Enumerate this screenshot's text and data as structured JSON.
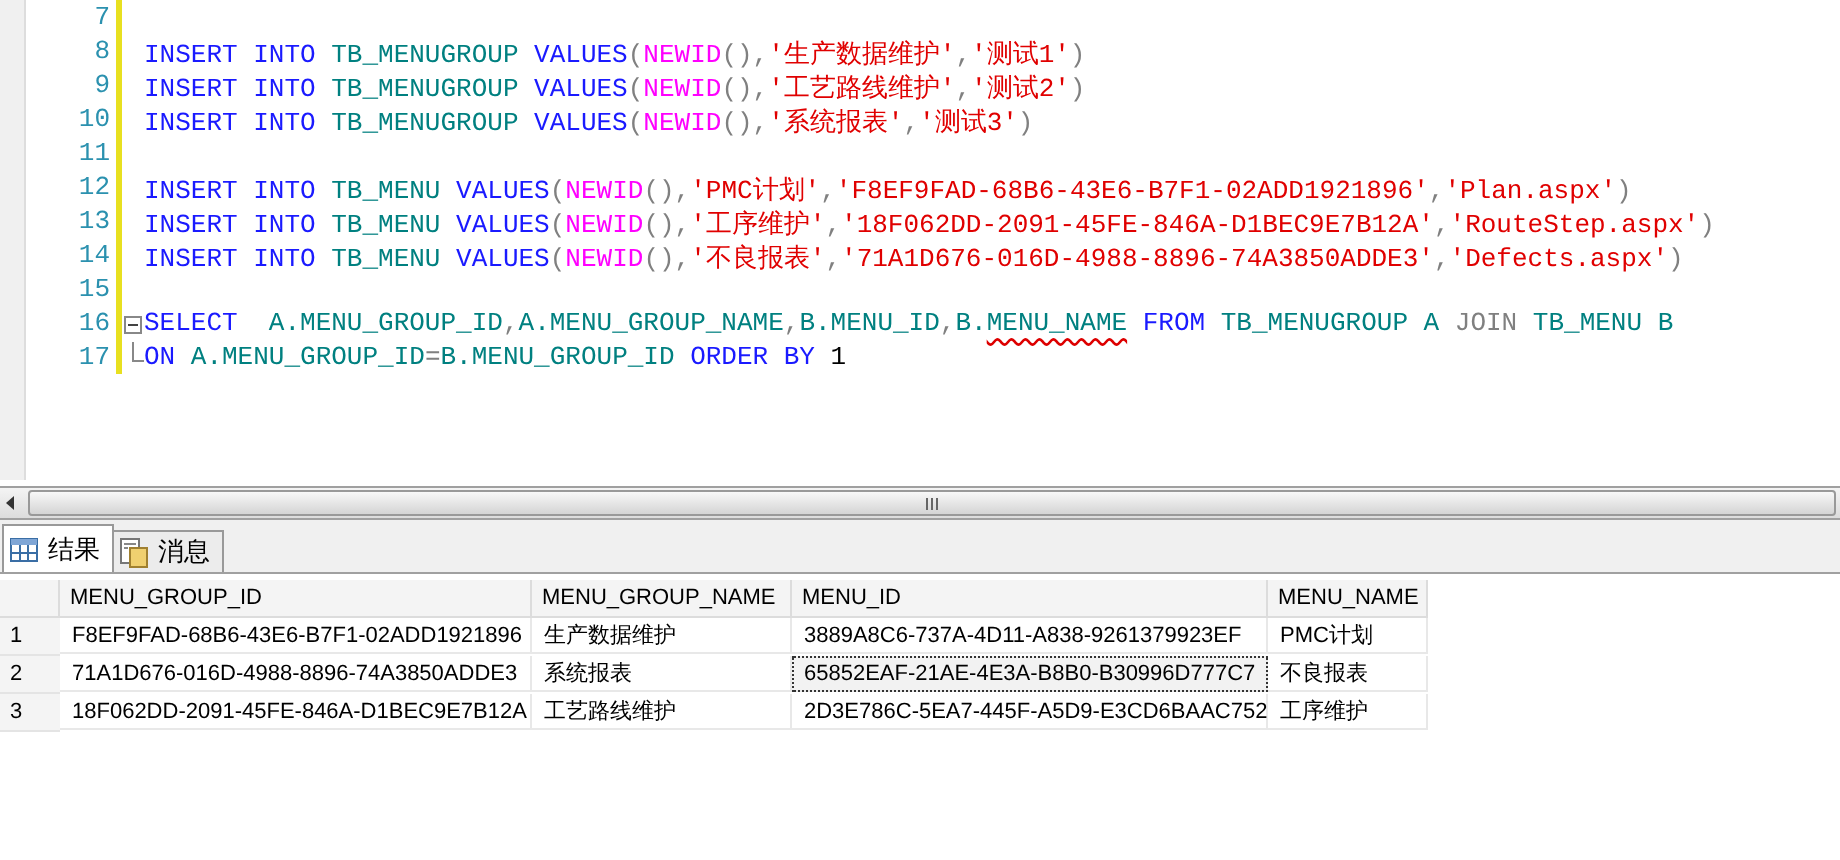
{
  "editor": {
    "lines": [
      {
        "number": "7"
      },
      {
        "number": "8",
        "tokens": [
          {
            "kind": "kw",
            "text": "INSERT INTO "
          },
          {
            "kind": "obj",
            "text": "TB_MENUGROUP "
          },
          {
            "kind": "kw",
            "text": "VALUES"
          },
          {
            "kind": "punct",
            "text": "("
          },
          {
            "kind": "fn",
            "text": "NEWID"
          },
          {
            "kind": "punct",
            "text": "(),"
          },
          {
            "kind": "str",
            "text": "'生产数据维护'"
          },
          {
            "kind": "punct",
            "text": ","
          },
          {
            "kind": "str",
            "text": "'测试1'"
          },
          {
            "kind": "punct",
            "text": ")"
          }
        ]
      },
      {
        "number": "9",
        "tokens": [
          {
            "kind": "kw",
            "text": "INSERT INTO "
          },
          {
            "kind": "obj",
            "text": "TB_MENUGROUP "
          },
          {
            "kind": "kw",
            "text": "VALUES"
          },
          {
            "kind": "punct",
            "text": "("
          },
          {
            "kind": "fn",
            "text": "NEWID"
          },
          {
            "kind": "punct",
            "text": "(),"
          },
          {
            "kind": "str",
            "text": "'工艺路线维护'"
          },
          {
            "kind": "punct",
            "text": ","
          },
          {
            "kind": "str",
            "text": "'测试2'"
          },
          {
            "kind": "punct",
            "text": ")"
          }
        ]
      },
      {
        "number": "10",
        "tokens": [
          {
            "kind": "kw",
            "text": "INSERT INTO "
          },
          {
            "kind": "obj",
            "text": "TB_MENUGROUP "
          },
          {
            "kind": "kw",
            "text": "VALUES"
          },
          {
            "kind": "punct",
            "text": "("
          },
          {
            "kind": "fn",
            "text": "NEWID"
          },
          {
            "kind": "punct",
            "text": "(),"
          },
          {
            "kind": "str",
            "text": "'系统报表'"
          },
          {
            "kind": "punct",
            "text": ","
          },
          {
            "kind": "str",
            "text": "'测试3'"
          },
          {
            "kind": "punct",
            "text": ")"
          }
        ]
      },
      {
        "number": "11"
      },
      {
        "number": "12",
        "tokens": [
          {
            "kind": "kw",
            "text": "INSERT INTO "
          },
          {
            "kind": "obj",
            "text": "TB_MENU "
          },
          {
            "kind": "kw",
            "text": "VALUES"
          },
          {
            "kind": "punct",
            "text": "("
          },
          {
            "kind": "fn",
            "text": "NEWID"
          },
          {
            "kind": "punct",
            "text": "(),"
          },
          {
            "kind": "str",
            "text": "'PMC计划'"
          },
          {
            "kind": "punct",
            "text": ","
          },
          {
            "kind": "str",
            "text": "'F8EF9FAD-68B6-43E6-B7F1-02ADD1921896'"
          },
          {
            "kind": "punct",
            "text": ","
          },
          {
            "kind": "str",
            "text": "'Plan.aspx'"
          },
          {
            "kind": "punct",
            "text": ")"
          }
        ]
      },
      {
        "number": "13",
        "tokens": [
          {
            "kind": "kw",
            "text": "INSERT INTO "
          },
          {
            "kind": "obj",
            "text": "TB_MENU "
          },
          {
            "kind": "kw",
            "text": "VALUES"
          },
          {
            "kind": "punct",
            "text": "("
          },
          {
            "kind": "fn",
            "text": "NEWID"
          },
          {
            "kind": "punct",
            "text": "(),"
          },
          {
            "kind": "str",
            "text": "'工序维护'"
          },
          {
            "kind": "punct",
            "text": ","
          },
          {
            "kind": "str",
            "text": "'18F062DD-2091-45FE-846A-D1BEC9E7B12A'"
          },
          {
            "kind": "punct",
            "text": ","
          },
          {
            "kind": "str",
            "text": "'RouteStep.aspx'"
          },
          {
            "kind": "punct",
            "text": ")"
          }
        ]
      },
      {
        "number": "14",
        "tokens": [
          {
            "kind": "kw",
            "text": "INSERT INTO "
          },
          {
            "kind": "obj",
            "text": "TB_MENU "
          },
          {
            "kind": "kw",
            "text": "VALUES"
          },
          {
            "kind": "punct",
            "text": "("
          },
          {
            "kind": "fn",
            "text": "NEWID"
          },
          {
            "kind": "punct",
            "text": "(),"
          },
          {
            "kind": "str",
            "text": "'不良报表'"
          },
          {
            "kind": "punct",
            "text": ","
          },
          {
            "kind": "str",
            "text": "'71A1D676-016D-4988-8896-74A3850ADDE3'"
          },
          {
            "kind": "punct",
            "text": ","
          },
          {
            "kind": "str",
            "text": "'Defects.aspx'"
          },
          {
            "kind": "punct",
            "text": ")"
          }
        ]
      },
      {
        "number": "15"
      },
      {
        "number": "16",
        "kind": "fold_start",
        "tokens": [
          {
            "kind": "kw",
            "text": "SELECT  "
          },
          {
            "kind": "obj",
            "text": "A.MENU_GROUP_ID"
          },
          {
            "kind": "punct",
            "text": ","
          },
          {
            "kind": "obj",
            "text": "A.MENU_GROUP_NAME"
          },
          {
            "kind": "punct",
            "text": ","
          },
          {
            "kind": "obj",
            "text": "B.MENU_ID"
          },
          {
            "kind": "punct",
            "text": ","
          },
          {
            "kind": "obj",
            "text": "B."
          },
          {
            "kind": "flagged",
            "text": "MENU_NAME"
          },
          {
            "kind": "kw",
            "text": " FROM "
          },
          {
            "kind": "obj",
            "text": "TB_MENUGROUP A "
          },
          {
            "kind": "punct",
            "text": "JOIN "
          },
          {
            "kind": "obj",
            "text": "TB_MENU B"
          }
        ]
      },
      {
        "number": "17",
        "kind": "fold_end",
        "tokens": [
          {
            "kind": "kw",
            "text": "ON "
          },
          {
            "kind": "obj",
            "text": "A.MENU_GROUP_ID"
          },
          {
            "kind": "punct",
            "text": "="
          },
          {
            "kind": "obj",
            "text": "B.MENU_GROUP_ID "
          },
          {
            "kind": "kw",
            "text": "ORDER BY "
          },
          {
            "kind": "plain",
            "text": "1"
          }
        ]
      }
    ]
  },
  "result_tabs": [
    {
      "label": "结果",
      "kind": "grid",
      "selected": true
    },
    {
      "label": "消息",
      "kind": "doc",
      "selected": false
    }
  ],
  "grid": {
    "columns": [
      "MENU_GROUP_ID",
      "MENU_GROUP_NAME",
      "MENU_ID",
      "MENU_NAME"
    ],
    "rows": [
      {
        "number": "1",
        "cells": [
          {
            "text": "F8EF9FAD-68B6-43E6-B7F1-02ADD1921896",
            "focused": false
          },
          {
            "text": "生产数据维护",
            "focused": false
          },
          {
            "text": "3889A8C6-737A-4D11-A838-9261379923EF",
            "focused": false
          },
          {
            "text": "PMC计划",
            "focused": false
          }
        ]
      },
      {
        "number": "2",
        "cells": [
          {
            "text": "71A1D676-016D-4988-8896-74A3850ADDE3",
            "focused": false
          },
          {
            "text": "系统报表",
            "focused": false
          },
          {
            "text": "65852EAF-21AE-4E3A-B8B0-B30996D777C7",
            "focused": true
          },
          {
            "text": "不良报表",
            "focused": false
          }
        ]
      },
      {
        "number": "3",
        "cells": [
          {
            "text": "18F062DD-2091-45FE-846A-D1BEC9E7B12A",
            "focused": false
          },
          {
            "text": "工艺路线维护",
            "focused": false
          },
          {
            "text": "2D3E786C-5EA7-445F-A5D9-E3CD6BAAC752",
            "focused": false
          },
          {
            "text": "工序维护",
            "focused": false
          }
        ]
      }
    ]
  }
}
